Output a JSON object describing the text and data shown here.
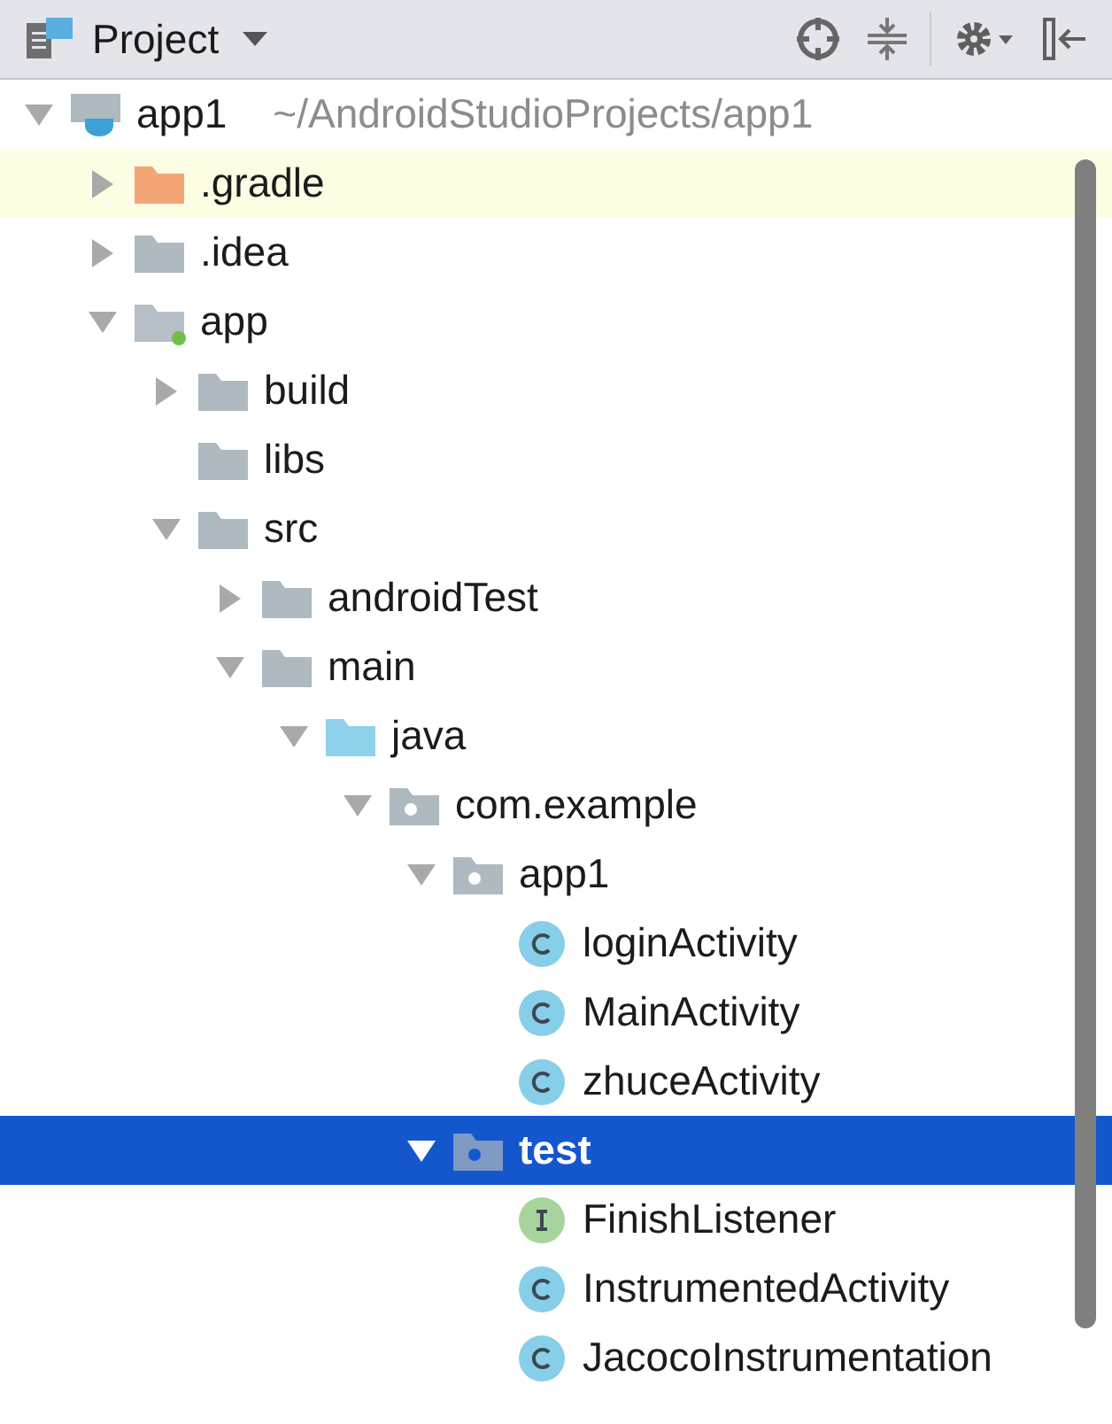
{
  "header": {
    "title": "Project"
  },
  "tree": [
    {
      "kind": "project",
      "label": "app1",
      "description": "~/AndroidStudioProjects/app1",
      "expanded": true,
      "selected": false,
      "children": [
        {
          "kind": "excluded-folder",
          "label": ".gradle",
          "expanded": false,
          "selected": false
        },
        {
          "kind": "folder",
          "label": ".idea",
          "expanded": false,
          "selected": false
        },
        {
          "kind": "module",
          "label": "app",
          "expanded": true,
          "selected": false,
          "children": [
            {
              "kind": "folder",
              "label": "build",
              "expanded": false,
              "selected": false
            },
            {
              "kind": "folder",
              "label": "libs",
              "selected": false
            },
            {
              "kind": "folder",
              "label": "src",
              "expanded": true,
              "selected": false,
              "children": [
                {
                  "kind": "folder",
                  "label": "androidTest",
                  "expanded": false,
                  "selected": false
                },
                {
                  "kind": "folder",
                  "label": "main",
                  "expanded": true,
                  "selected": false,
                  "children": [
                    {
                      "kind": "source-folder",
                      "label": "java",
                      "expanded": true,
                      "selected": false,
                      "children": [
                        {
                          "kind": "package",
                          "label": "com.example",
                          "expanded": true,
                          "selected": false,
                          "children": [
                            {
                              "kind": "package",
                              "label": "app1",
                              "expanded": true,
                              "selected": false,
                              "children": [
                                {
                                  "kind": "class",
                                  "label": "loginActivity",
                                  "selected": false
                                },
                                {
                                  "kind": "class",
                                  "label": "MainActivity",
                                  "selected": false
                                },
                                {
                                  "kind": "class",
                                  "label": "zhuceActivity",
                                  "selected": false
                                }
                              ]
                            },
                            {
                              "kind": "package",
                              "label": "test",
                              "expanded": true,
                              "selected": true,
                              "children": [
                                {
                                  "kind": "interface",
                                  "label": "FinishListener",
                                  "selected": false
                                },
                                {
                                  "kind": "class",
                                  "label": "InstrumentedActivity",
                                  "selected": false
                                },
                                {
                                  "kind": "class",
                                  "label": "JacocoInstrumentation",
                                  "selected": false
                                }
                              ]
                            }
                          ]
                        }
                      ]
                    }
                  ]
                }
              ]
            }
          ]
        }
      ]
    }
  ]
}
